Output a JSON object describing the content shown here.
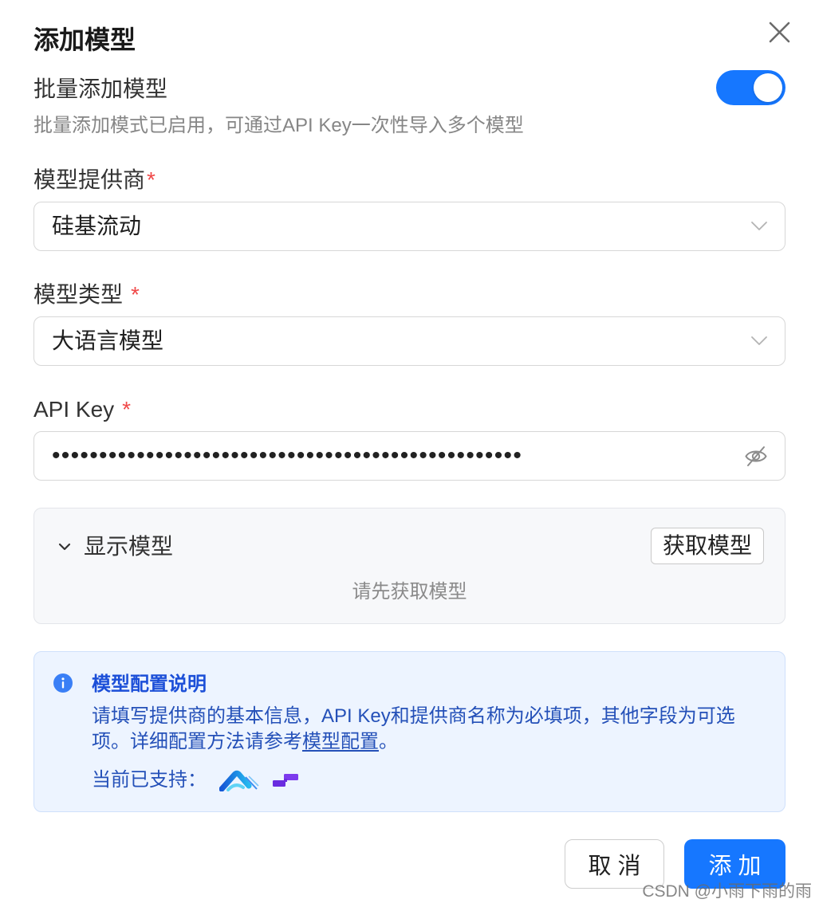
{
  "dialog": {
    "title": "添加模型"
  },
  "batch_mode": {
    "label": "批量添加模型",
    "enabled": true,
    "hint": "批量添加模式已启用，可通过API Key一次性导入多个模型"
  },
  "form": {
    "provider": {
      "label": "模型提供商",
      "required_mark": "*",
      "value": "硅基流动"
    },
    "model_type": {
      "label": "模型类型",
      "required_mark": "*",
      "value": "大语言模型"
    },
    "api_key": {
      "label": "API Key",
      "required_mark": "*",
      "value": "••••••••••••••••••••••••••••••••••••••••••••••••••"
    }
  },
  "models_panel": {
    "toggle_label": "显示模型",
    "fetch_button": "获取模型",
    "empty_text": "请先获取模型"
  },
  "info": {
    "title": "模型配置说明",
    "text_before_link": "请填写提供商的基本信息，API Key和提供商名称为必填项，其他字段为可选项。详细配置方法请参考",
    "link_text": "模型配置",
    "text_after_link": "。",
    "supported_label": "当前已支持："
  },
  "footer": {
    "cancel": "取 消",
    "submit": "添 加"
  },
  "watermark": "CSDN @小雨下雨的雨",
  "icons": {
    "close": "close-icon",
    "select_arrow": "chevron-down-icon",
    "api_key_visibility": "eye-off-icon",
    "panel_toggle": "chevron-down-icon",
    "info": "info-icon",
    "supported_logos": [
      "wave-logo-icon",
      "blocks-logo-icon"
    ]
  },
  "colors": {
    "primary": "#1677ff",
    "required_mark": "#f04848",
    "info_title": "#1c4fd8",
    "info_text": "#2450b8",
    "info_background": "#edf4ff",
    "panel_background": "#f7f8fa"
  }
}
